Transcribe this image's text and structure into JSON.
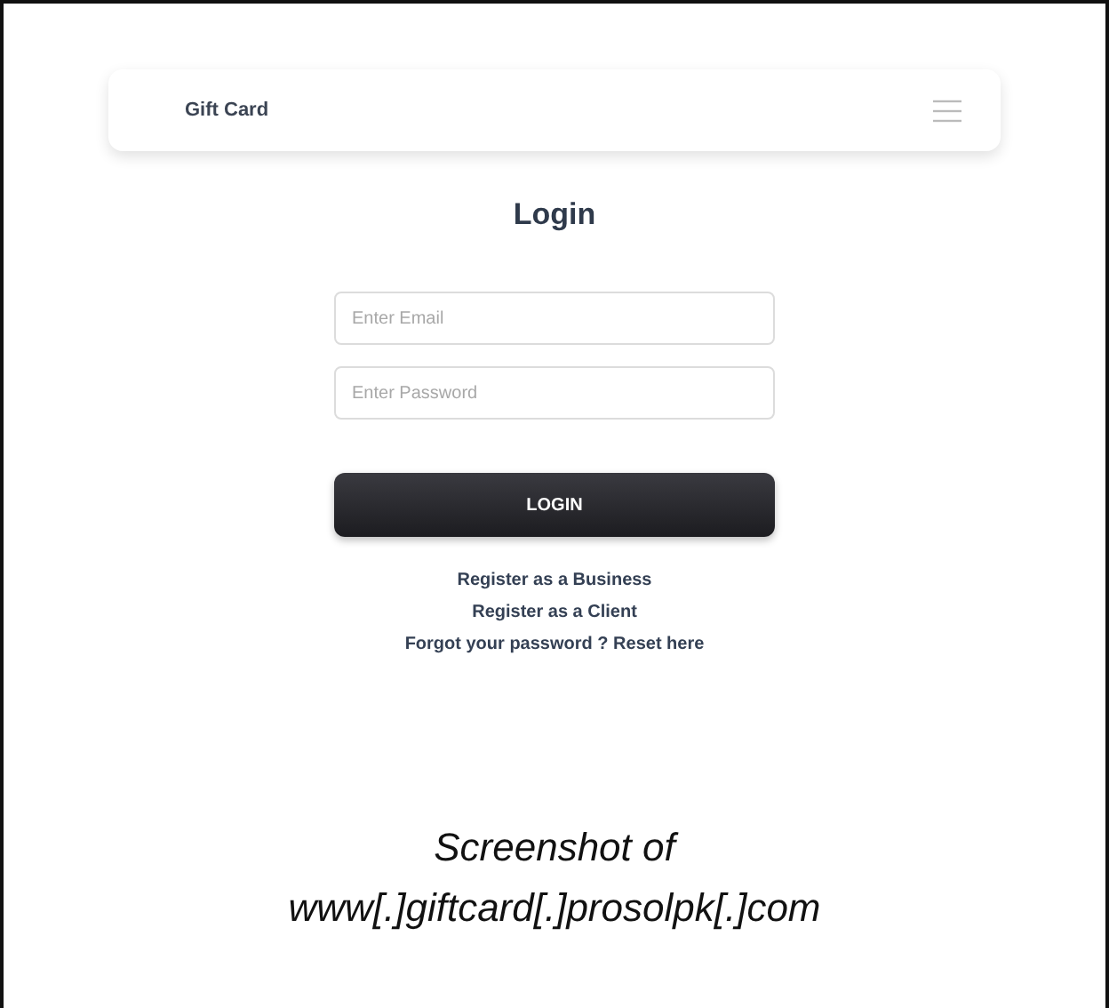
{
  "navbar": {
    "brand": "Gift Card"
  },
  "title": "Login",
  "fields": [
    {
      "placeholder": "Enter Email"
    },
    {
      "placeholder": "Enter Password"
    }
  ],
  "button": "LOGIN",
  "links": [
    "Register as a Business",
    "Register as a Client",
    "Forgot your password ? Reset here"
  ],
  "caption": [
    "Screenshot of",
    "www[.]giftcard[.]prosolpk[.]com"
  ]
}
